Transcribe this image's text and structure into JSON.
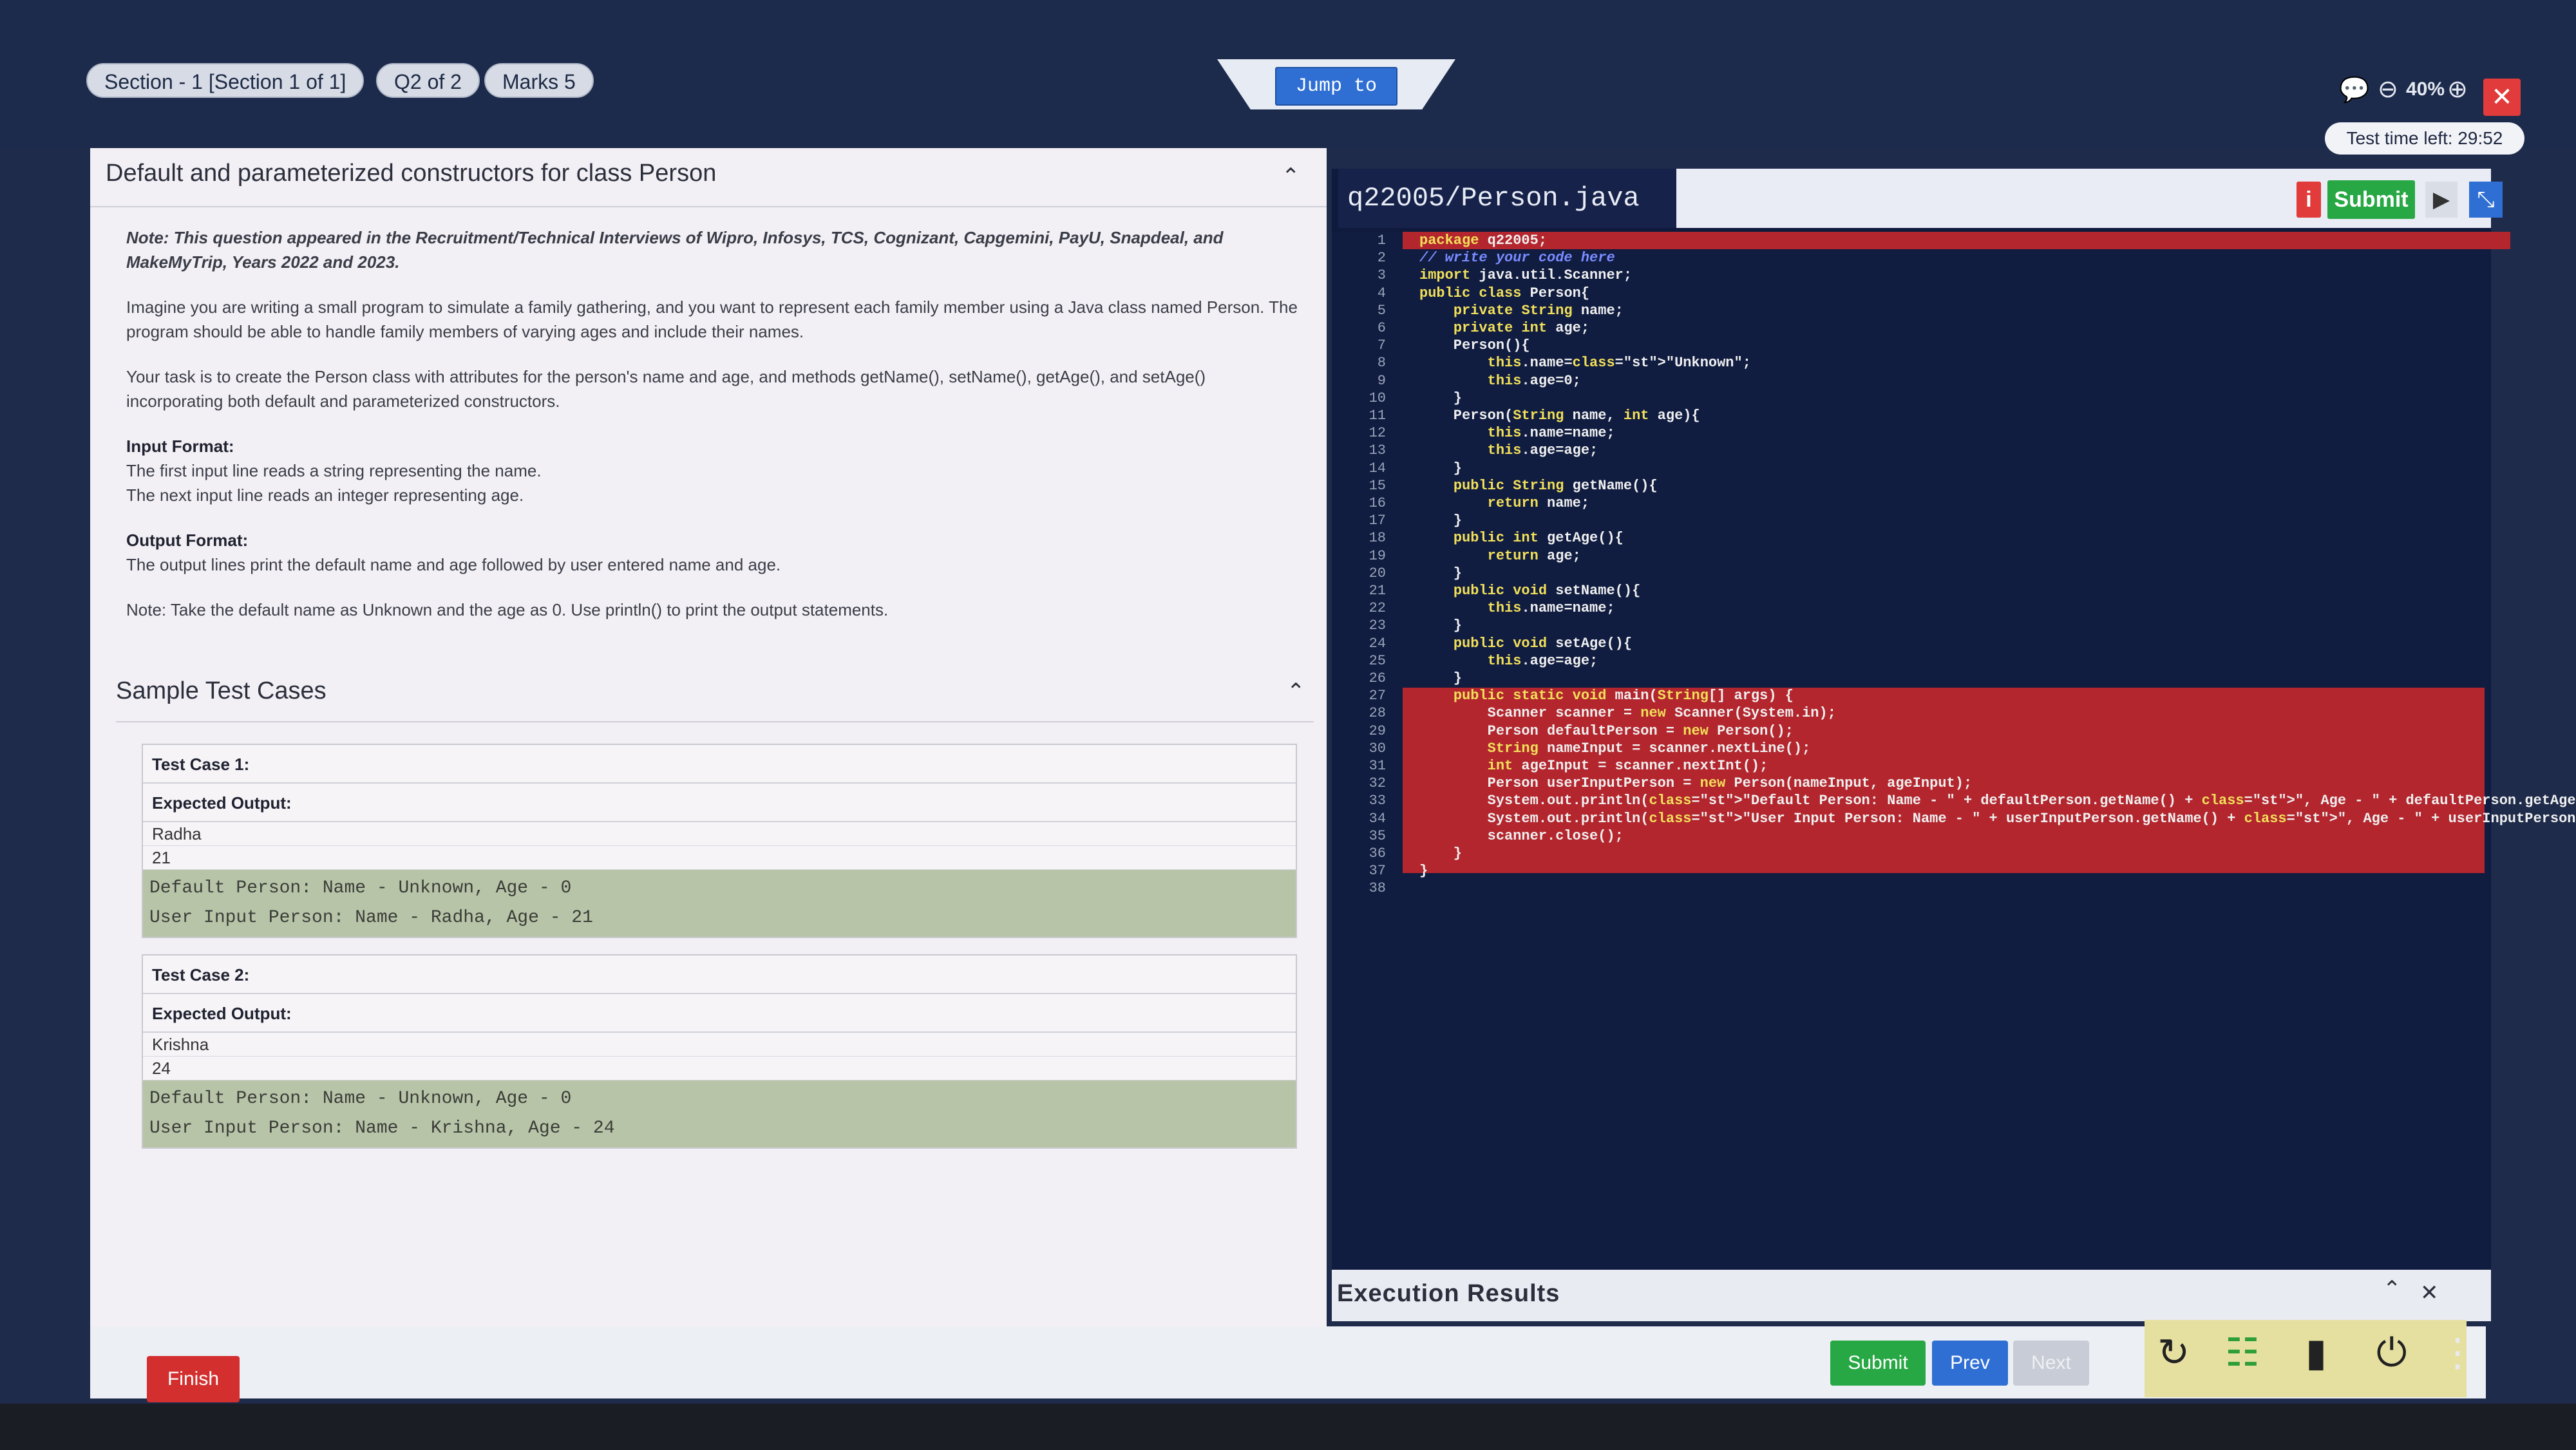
{
  "topbar": {
    "section_label": "Section - 1 [Section 1 of 1]",
    "question_label": "Q2 of 2",
    "marks_label": "Marks 5",
    "jump_label": "Jump to",
    "zoom_label": "40%",
    "time_left": "Test time left: 29:52",
    "icons": [
      "chat-icon",
      "zoom-out-icon",
      "zoom-in-icon",
      "close-icon"
    ]
  },
  "question": {
    "title": "Default and parameterized constructors for class Person",
    "note": "Note: This question appeared in the Recruitment/Technical Interviews of Wipro, Infosys, TCS, Cognizant, Capgemini, PayU, Snapdeal, and MakeMyTrip, Years 2022 and 2023.",
    "intro": "Imagine you are writing a small program to simulate a family gathering, and you want to represent each family member using a Java class named Person. The program should be able to handle family members of varying ages and include their names.",
    "task": "Your task is to create the Person class with attributes for the person's name and age, and methods getName(), setName(), getAge(), and setAge() incorporating both default and parameterized constructors.",
    "input_heading": "Input Format:",
    "input_line1": "The first input line reads a string representing the name.",
    "input_line2": "The next input line reads an integer representing age.",
    "output_heading": "Output Format:",
    "output_line": "The output lines print the default name and age followed by user entered name and age.",
    "final_note": "Note: Take the default name as Unknown and the age as 0. Use println() to print the output statements."
  },
  "samples": {
    "title": "Sample Test Cases",
    "cases": [
      {
        "label": "Test Case 1:",
        "expected_label": "Expected Output:",
        "input1": "Radha",
        "input2": "21",
        "out1": "Default Person: Name - Unknown, Age - 0",
        "out2": "User Input Person: Name - Radha, Age - 21"
      },
      {
        "label": "Test Case 2:",
        "expected_label": "Expected Output:",
        "input1": "Krishna",
        "input2": "24",
        "out1": "Default Person: Name - Unknown, Age - 0",
        "out2": "User Input Person: Name - Krishna, Age - 24"
      }
    ]
  },
  "editor": {
    "file_name": "q22005/Person.java",
    "submit_label": "Submit",
    "info_label": "i",
    "lines": [
      "package q22005;",
      "// write your code here",
      "import java.util.Scanner;",
      "public class Person{",
      "    private String name;",
      "    private int age;",
      "    Person(){",
      "        this.name=\"Unknown\";",
      "        this.age=0;",
      "    }",
      "    Person(String name, int age){",
      "        this.name=name;",
      "        this.age=age;",
      "    }",
      "    public String getName(){",
      "        return name;",
      "    }",
      "    public int getAge(){",
      "        return age;",
      "    }",
      "    public void setName(){",
      "        this.name=name;",
      "    }",
      "    public void setAge(){",
      "        this.age=age;",
      "    }",
      "    public static void main(String[] args) {",
      "        Scanner scanner = new Scanner(System.in);",
      "        Person defaultPerson = new Person();",
      "        String nameInput = scanner.nextLine();",
      "        int ageInput = scanner.nextInt();",
      "        Person userInputPerson = new Person(nameInput, ageInput);",
      "        System.out.println(\"Default Person: Name - \" + defaultPerson.getName() + \", Age - \" + defaultPerson.getAge());",
      "        System.out.println(\"User Input Person: Name - \" + userInputPerson.getName() + \", Age - \" + userInputPerson.getAge());",
      "        scanner.close();",
      "    }",
      "}",
      ""
    ]
  },
  "execution": {
    "title": "Execution Results"
  },
  "footer": {
    "finish_label": "Finish",
    "submit_label": "Submit",
    "prev_label": "Prev",
    "next_label": "Next"
  },
  "colors": {
    "background": "#1e2b4a",
    "error_highlight": "#b3262e",
    "submit_green": "#27a844",
    "prev_blue": "#2f6fd3",
    "finish_red": "#d32f2f"
  }
}
